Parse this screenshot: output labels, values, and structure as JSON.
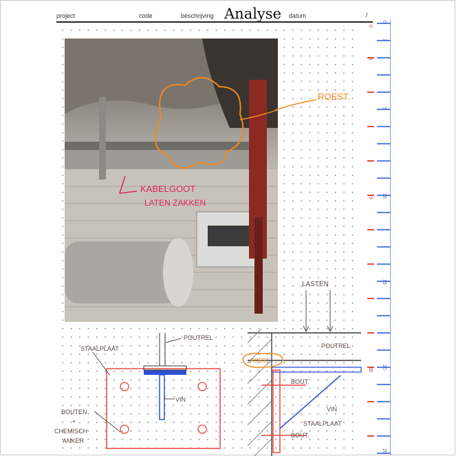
{
  "header": {
    "project_label": "project",
    "code_label": "code",
    "description_label": "beschrijving",
    "title": "Analyse",
    "date_label": "datum",
    "slash": "/"
  },
  "colors": {
    "orange_ink": "#f08a1c",
    "red_ink": "#e0245e",
    "blue_ink": "#2d4fd6",
    "dark_ink": "#5a4b44",
    "red_outline": "#e8483f"
  },
  "photo_annotations": {
    "rust_label": "ROEST.",
    "cable_tray_line1": "KABELGOOT",
    "cable_tray_line2": "LATEN ZAKKEN"
  },
  "sketch_left": {
    "steel_plate": "STAALPLAAT",
    "beam": "POUTREL",
    "fin": "VIN",
    "bolts": "BOUTEN",
    "plus": "+",
    "chemical": "CHEMISCH",
    "anchor": "ANKER"
  },
  "sketch_right": {
    "loads": "LASTEN",
    "beam": "POUTREL",
    "rust": "ROEST",
    "bolt_top": "BOUT.",
    "fin": "VIN",
    "steel_plate": "STAALPLAAT",
    "bolt_bottom": "BOUT."
  },
  "ruler": {
    "blue_labels": [
      "0",
      "1",
      "5",
      "10",
      "15",
      "20",
      "10",
      "20"
    ],
    "red_labels": [
      "0",
      "1",
      "5",
      "10"
    ]
  }
}
